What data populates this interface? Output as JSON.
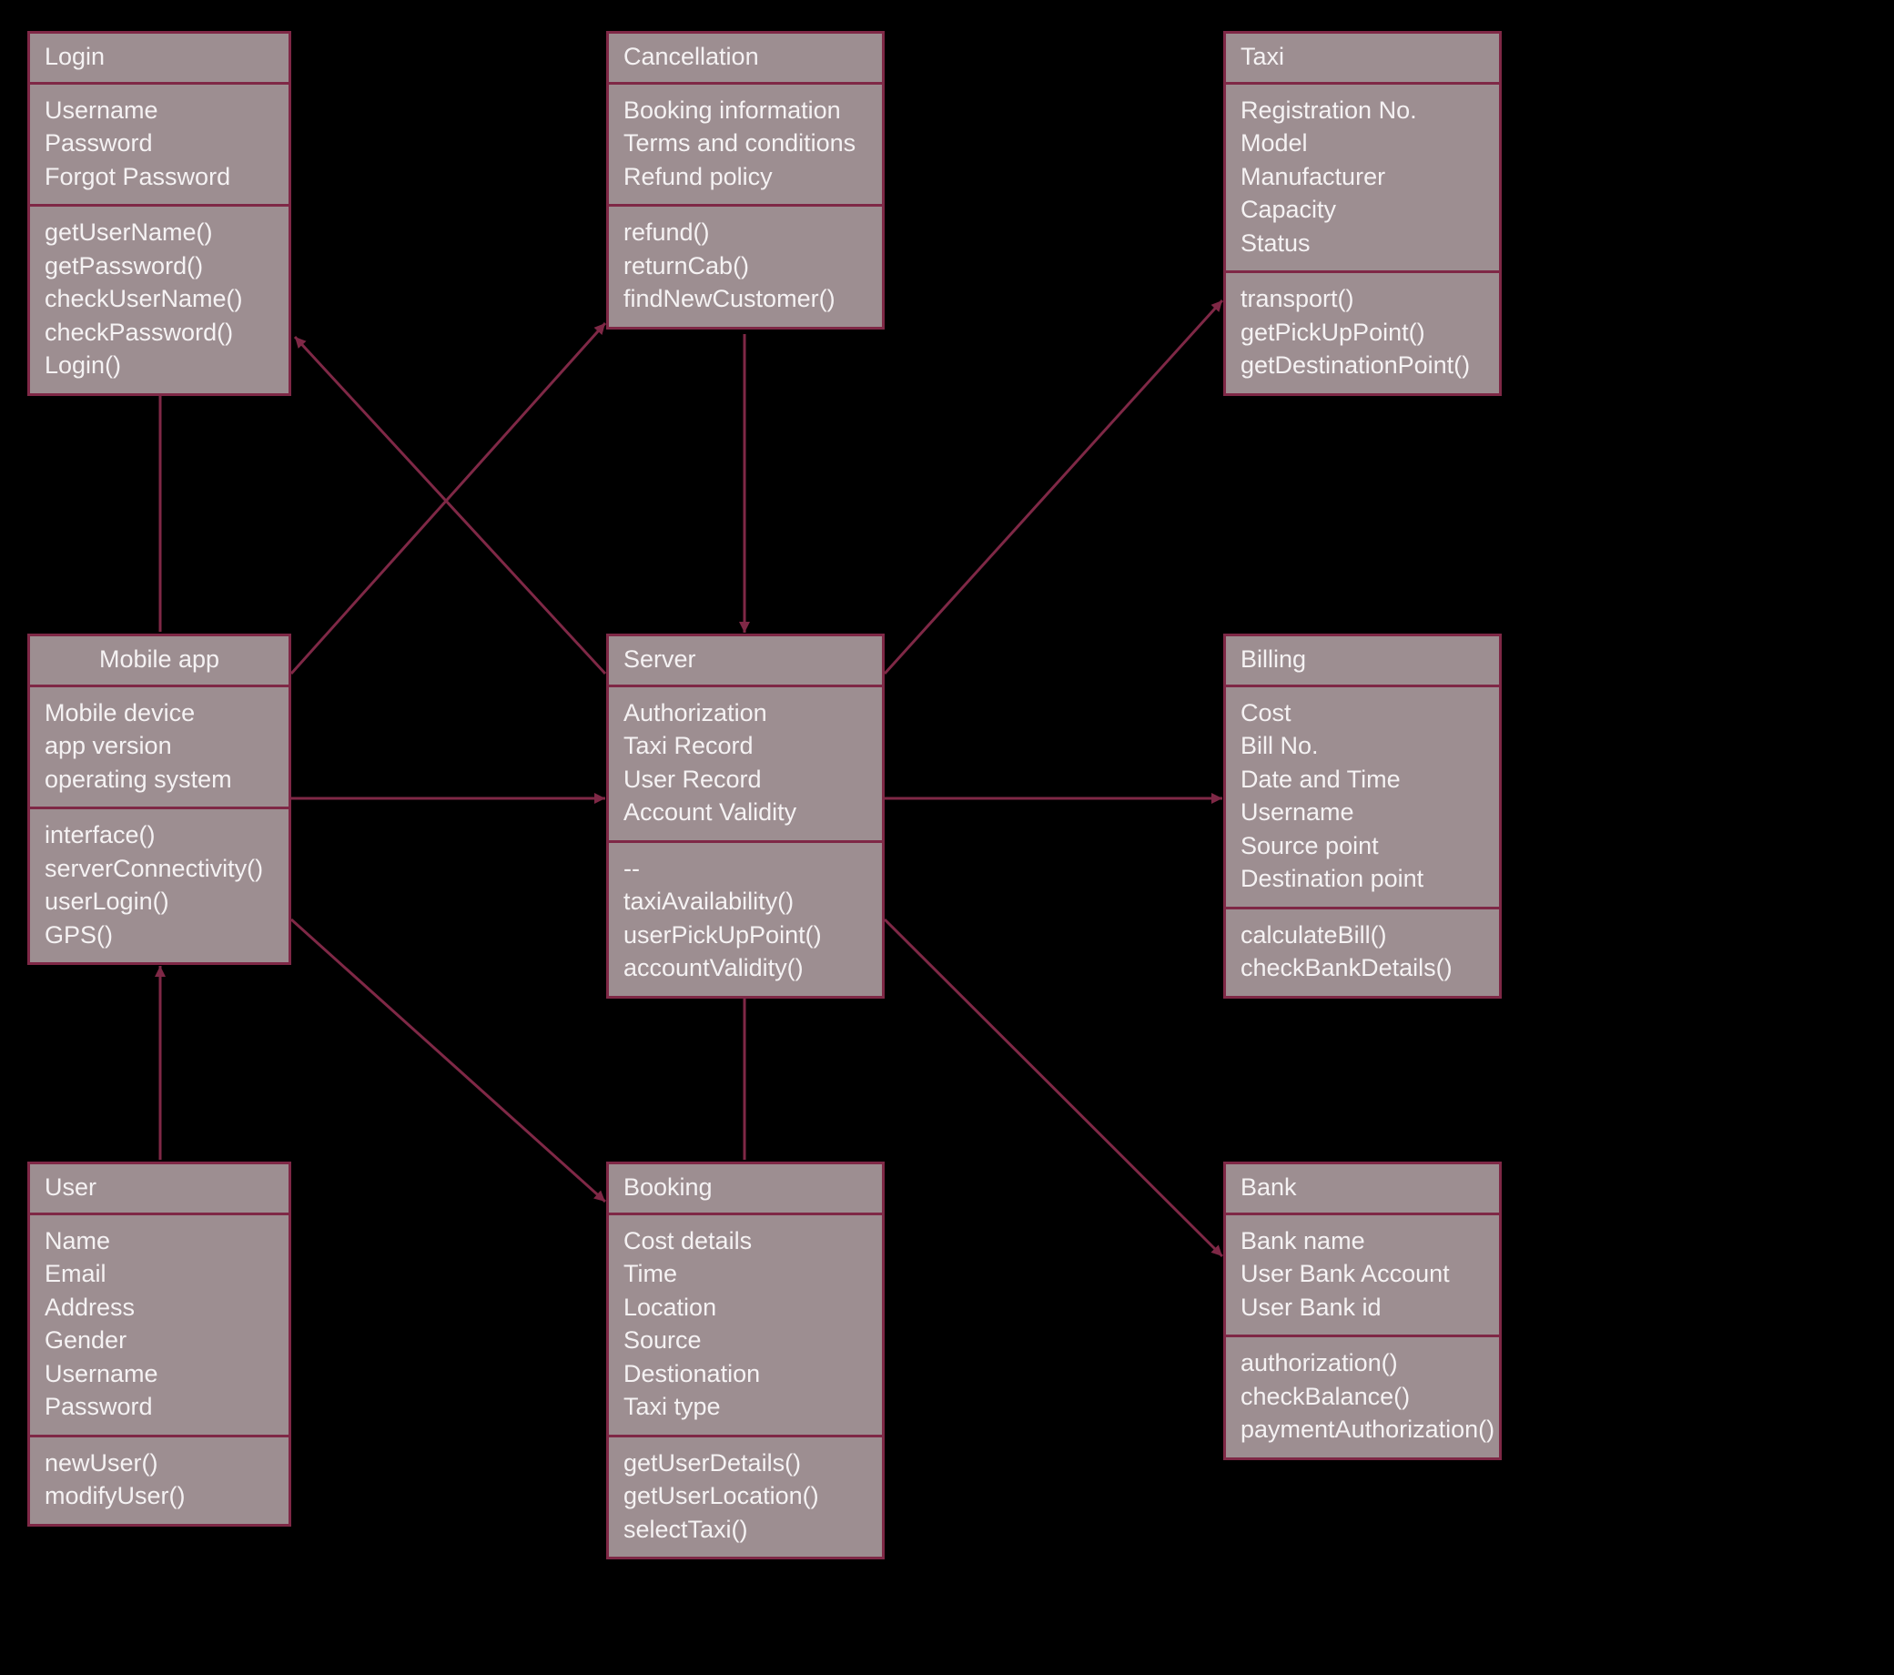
{
  "classes": {
    "login": {
      "title": "Login",
      "attrs": [
        "Username",
        "Password",
        "Forgot Password"
      ],
      "methods": [
        "getUserName()",
        "getPassword()",
        "checkUserName()",
        "checkPassword()",
        "Login()"
      ]
    },
    "cancellation": {
      "title": "Cancellation",
      "attrs": [
        "Booking information",
        "Terms and conditions",
        "Refund policy"
      ],
      "methods": [
        "refund()",
        "returnCab()",
        "findNewCustomer()"
      ]
    },
    "taxi": {
      "title": "Taxi",
      "attrs": [
        "Registration No.",
        "Model",
        "Manufacturer",
        "Capacity",
        "Status"
      ],
      "methods": [
        "transport()",
        "getPickUpPoint()",
        "getDestinationPoint()"
      ]
    },
    "mobileapp": {
      "title": "Mobile app",
      "attrs": [
        "Mobile device",
        "app version",
        "operating system"
      ],
      "methods": [
        "interface()",
        "serverConnectivity()",
        "userLogin()",
        "GPS()"
      ]
    },
    "server": {
      "title": "Server",
      "attrs": [
        "Authorization",
        "Taxi Record",
        "User Record",
        "Account Validity"
      ],
      "methods": [
        "--",
        "taxiAvailability()",
        "userPickUpPoint()",
        "accountValidity()"
      ]
    },
    "billing": {
      "title": "Billing",
      "attrs": [
        "Cost",
        "Bill No.",
        "Date and Time",
        "Username",
        "Source point",
        "Destination point"
      ],
      "methods": [
        "calculateBill()",
        "checkBankDetails()"
      ]
    },
    "user": {
      "title": "User",
      "attrs": [
        "Name",
        "Email",
        "Address",
        "Gender",
        "Username",
        "Password"
      ],
      "methods": [
        "newUser()",
        "modifyUser()"
      ]
    },
    "booking": {
      "title": "Booking",
      "attrs": [
        "Cost details",
        "Time",
        "Location",
        "Source",
        "Destionation",
        "Taxi type"
      ],
      "methods": [
        "getUserDetails()",
        "getUserLocation()",
        "selectTaxi()"
      ]
    },
    "bank": {
      "title": "Bank",
      "attrs": [
        "Bank name",
        "User Bank Account",
        "User Bank id"
      ],
      "methods": [
        "authorization()",
        "checkBalance()",
        "paymentAuthorization()"
      ]
    }
  }
}
